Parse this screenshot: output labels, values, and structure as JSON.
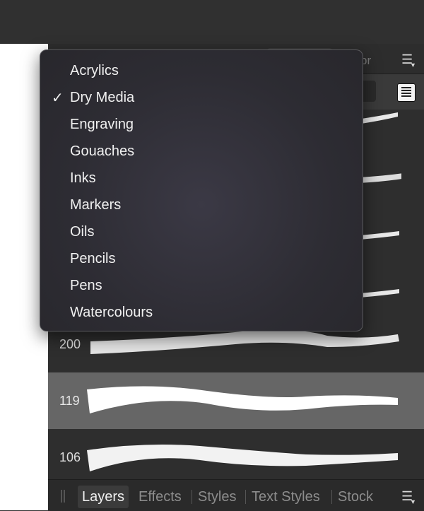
{
  "panel": {
    "header_tab_label": "pr"
  },
  "brush_category_menu": {
    "selected": "Dry Media",
    "items": [
      {
        "label": "Acrylics",
        "check": ""
      },
      {
        "label": "Dry Media",
        "check": "✓"
      },
      {
        "label": "Engraving",
        "check": ""
      },
      {
        "label": "Gouaches",
        "check": ""
      },
      {
        "label": "Inks",
        "check": ""
      },
      {
        "label": "Markers",
        "check": ""
      },
      {
        "label": "Oils",
        "check": ""
      },
      {
        "label": "Pencils",
        "check": ""
      },
      {
        "label": "Pens",
        "check": ""
      },
      {
        "label": "Watercolours",
        "check": ""
      }
    ]
  },
  "brushes": [
    {
      "size": ""
    },
    {
      "size": ""
    },
    {
      "size": ""
    },
    {
      "size": ""
    },
    {
      "size": "200"
    },
    {
      "size": "119",
      "selected": true
    },
    {
      "size": "106"
    }
  ],
  "bottom_tabs": [
    {
      "label": "Layers",
      "active": true
    },
    {
      "label": "Effects"
    },
    {
      "label": "Styles"
    },
    {
      "label": "Text Styles"
    },
    {
      "label": "Stock"
    }
  ],
  "icons": {
    "panel_menu": "panel-menu-icon",
    "list_view": "list-view-icon",
    "grip": "grip-handle-icon",
    "check": "checkmark-icon"
  },
  "colors": {
    "selected_row": "#666666",
    "menu_background": "#2d2c33",
    "text_active": "#f0f0f0",
    "text_inactive": "#8d8d8d"
  }
}
